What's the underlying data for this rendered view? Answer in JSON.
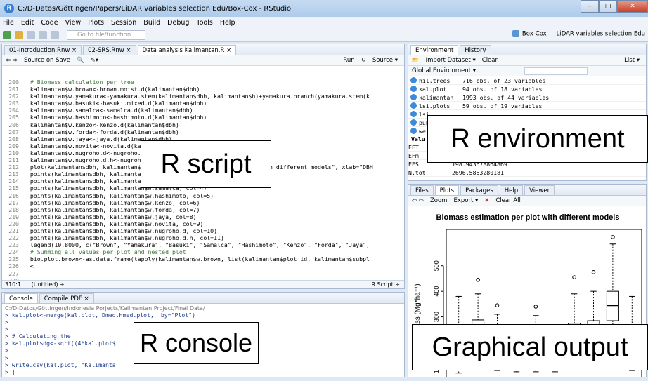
{
  "window": {
    "title": "C:/D-Datos/Göttingen/Papers/LiDAR variables selection Edu/Box-Cox - RStudio",
    "min": "–",
    "max": "□",
    "close": "✕"
  },
  "menu": [
    "File",
    "Edit",
    "Code",
    "View",
    "Plots",
    "Session",
    "Build",
    "Debug",
    "Tools",
    "Help"
  ],
  "toolbar": {
    "goto_placeholder": "Go to file/function",
    "project": "Box-Cox — LiDAR variables selection Edu"
  },
  "editor": {
    "tabs": [
      "01-Introduction.Rnw ×",
      "02-SRS.Rnw ×",
      "Data analysis Kalimantan.R ×"
    ],
    "sub": {
      "source_on_save": "Source on Save",
      "run": "Run",
      "source": "Source ▾"
    },
    "lines": [
      {
        "n": "200",
        "t": ""
      },
      {
        "n": "201",
        "t": "  # Biomass calculation per tree",
        "c": "cm"
      },
      {
        "n": "202",
        "t": "  kalimantan$w.brown<-brown.moist.d(kalimantan$dbh)"
      },
      {
        "n": "203",
        "t": "  kalimantan$w.yamakura<-yamakura.stem(kalimantan$dbh, kalimantan$h)+yamakura.branch(yamakura.stem(k"
      },
      {
        "n": "204",
        "t": "  kalimantan$w.basuki<-basuki.mixed.d(kalimantan$dbh)"
      },
      {
        "n": "205",
        "t": "  kalimantan$w.samalca<-samalca.d(kalimantan$dbh)"
      },
      {
        "n": "206",
        "t": "  kalimantan$w.hashimoto<-hashimoto.d(kalimantan$dbh)"
      },
      {
        "n": "207",
        "t": "  kalimantan$w.kenzo<-kenzo.d(kalimantan$dbh)"
      },
      {
        "n": "208",
        "t": "  kalimantan$w.forda<-forda.d(kalimantan$dbh)"
      },
      {
        "n": "209",
        "t": "  kalimantan$w.jaya<-jaya.d(kalimantan$dbh)"
      },
      {
        "n": "210",
        "t": "  kalimantan$w.novita<-novita.d(kalimantan$dbh)"
      },
      {
        "n": "211",
        "t": "  kalimantan$w.nugroho.d<-nugroho.d(kalimantan$dbh)"
      },
      {
        "n": "212",
        "t": "  kalimantan$w.nugroho.d.h<-nugroho.d.h(kalimantan$dbh, kalimantan$h)"
      },
      {
        "n": "213",
        "t": ""
      },
      {
        "n": "214",
        "t": "  plot(kalimantan$dbh, kalimantan$w.brown, main=\"Biomass estimation with different models\", xlab=\"DBH"
      },
      {
        "n": "215",
        "t": "  points(kalimantan$dbh, kalimantan$w.yamakura, col=2)"
      },
      {
        "n": "216",
        "t": "  points(kalimantan$dbh, kalimantan$w.basuki, col=3)"
      },
      {
        "n": "217",
        "t": "  points(kalimantan$dbh, kalimantan$w.samalca, col=4)"
      },
      {
        "n": "218",
        "t": "  points(kalimantan$dbh, kalimantan$w.hashimoto, col=5)"
      },
      {
        "n": "219",
        "t": "  points(kalimantan$dbh, kalimantan$w.kenzo, col=6)"
      },
      {
        "n": "220",
        "t": "  points(kalimantan$dbh, kalimantan$w.forda, col=7)"
      },
      {
        "n": "221",
        "t": "  points(kalimantan$dbh, kalimantan$w.jaya, col=8)"
      },
      {
        "n": "222",
        "t": "  points(kalimantan$dbh, kalimantan$w.novita, col=9)"
      },
      {
        "n": "223",
        "t": "  points(kalimantan$dbh, kalimantan$w.nugroho.d, col=10)"
      },
      {
        "n": "224",
        "t": "  points(kalimantan$dbh, kalimantan$w.nugroho.d.h, col=11)"
      },
      {
        "n": "225",
        "t": ""
      },
      {
        "n": "226",
        "t": "  legend(10,8000, c(\"Brown\", \"Yamakura\", \"Basuki\", \"Samalca\", \"Hashimoto\", \"Kenzo\", \"Forda\", \"Jaya\","
      },
      {
        "n": "227",
        "t": ""
      },
      {
        "n": "228",
        "t": ""
      },
      {
        "n": "229",
        "t": "  # Summing all values per plot and nested plot",
        "c": "cm"
      },
      {
        "n": "230",
        "t": "  bio.plot.brown<-as.data.frame(tapply(kalimantan$w.brown, list(kalimantan$plot_id, kalimantan$subpl"
      },
      {
        "n": "231",
        "t": "  <"
      }
    ],
    "status_left": "310:1",
    "status_mid": "(Untitled) ÷",
    "status_right": "R Script ÷"
  },
  "console": {
    "tabs": [
      "Console",
      "Compile PDF ×"
    ],
    "path": "C:/D-Datos/Göttingen/Indonesia Porjects/Kalimantan Project/Final Data/",
    "lines": [
      "> kal.plot<-merge(kal.plot, Dmed.Hmed.plot,  by=\"Plot\")",
      ">",
      ">",
      "> # Calculating the                              AMETER",
      "> kal.plot$dg<-sqrt((4*kal.plot$",
      ">",
      ">",
      "> write.csv(kal.plot, \"Kalimanta",
      "> |"
    ]
  },
  "environment": {
    "tabs": [
      "Environment",
      "History"
    ],
    "toolbar": {
      "import": "Import Dataset ▾",
      "clear": "Clear",
      "list": "List ▾"
    },
    "scope": "Global Environment ▾",
    "rows": [
      {
        "name": "hil.trees",
        "desc": "716 obs. of 23 variables"
      },
      {
        "name": "kal.plot",
        "desc": "94 obs. of 18 variables"
      },
      {
        "name": "kalimantan",
        "desc": "1993 obs. of 44 variables"
      },
      {
        "name": "lsi.plots",
        "desc": "59 obs. of 19 variables"
      },
      {
        "name": "lsi",
        "desc": ""
      },
      {
        "name": "pub",
        "desc": ""
      },
      {
        "name": "wei",
        "desc": ""
      }
    ],
    "values_header": "Valu",
    "values": [
      {
        "name": "EFT",
        "desc": "12.4599.95290545"
      },
      {
        "name": "EFm",
        "desc": "49.7359197162173"
      },
      {
        "name": "EFS",
        "desc": "198.943678864869"
      },
      {
        "name": "N.tot",
        "desc": "2696.5863280181"
      }
    ]
  },
  "plots": {
    "tabs": [
      "Files",
      "Plots",
      "Packages",
      "Help",
      "Viewer"
    ],
    "toolbar": {
      "zoom": "Zoom",
      "export": "Export ▾",
      "clear": "Clear All"
    }
  },
  "chart_data": {
    "type": "box",
    "title": "Biomass estimation per plot with different models",
    "ylabel": "Biomass (Mg*ha⁻¹)",
    "yticks": [
      100,
      200,
      300,
      400,
      500
    ],
    "ylim": [
      60,
      620
    ],
    "boxes": [
      {
        "low": 80,
        "q1": 185,
        "med": 222,
        "q3": 265,
        "high": 380,
        "out": []
      },
      {
        "low": 95,
        "q1": 195,
        "med": 238,
        "q3": 288,
        "high": 390,
        "out": [
          445
        ]
      },
      {
        "low": 90,
        "q1": 160,
        "med": 188,
        "q3": 220,
        "high": 310,
        "out": [
          345
        ]
      },
      {
        "low": 85,
        "q1": 120,
        "med": 135,
        "q3": 155,
        "high": 205,
        "out": [
          218
        ]
      },
      {
        "low": 85,
        "q1": 160,
        "med": 188,
        "q3": 218,
        "high": 305,
        "out": [
          340
        ]
      },
      {
        "low": 85,
        "q1": 118,
        "med": 132,
        "q3": 148,
        "high": 195,
        "out": [
          210
        ]
      },
      {
        "low": 95,
        "q1": 180,
        "med": 225,
        "q3": 275,
        "high": 390,
        "out": [
          455
        ]
      },
      {
        "low": 100,
        "q1": 190,
        "med": 235,
        "q3": 285,
        "high": 400,
        "out": [
          475
        ]
      },
      {
        "low": 140,
        "q1": 285,
        "med": 345,
        "q3": 400,
        "high": 585,
        "out": [
          612
        ]
      },
      {
        "low": 90,
        "q1": 165,
        "med": 210,
        "q3": 265,
        "high": 380,
        "out": []
      }
    ]
  },
  "callouts": {
    "script": "R script",
    "environment": "R environment",
    "console": "R console",
    "graphics": "Graphical output"
  }
}
